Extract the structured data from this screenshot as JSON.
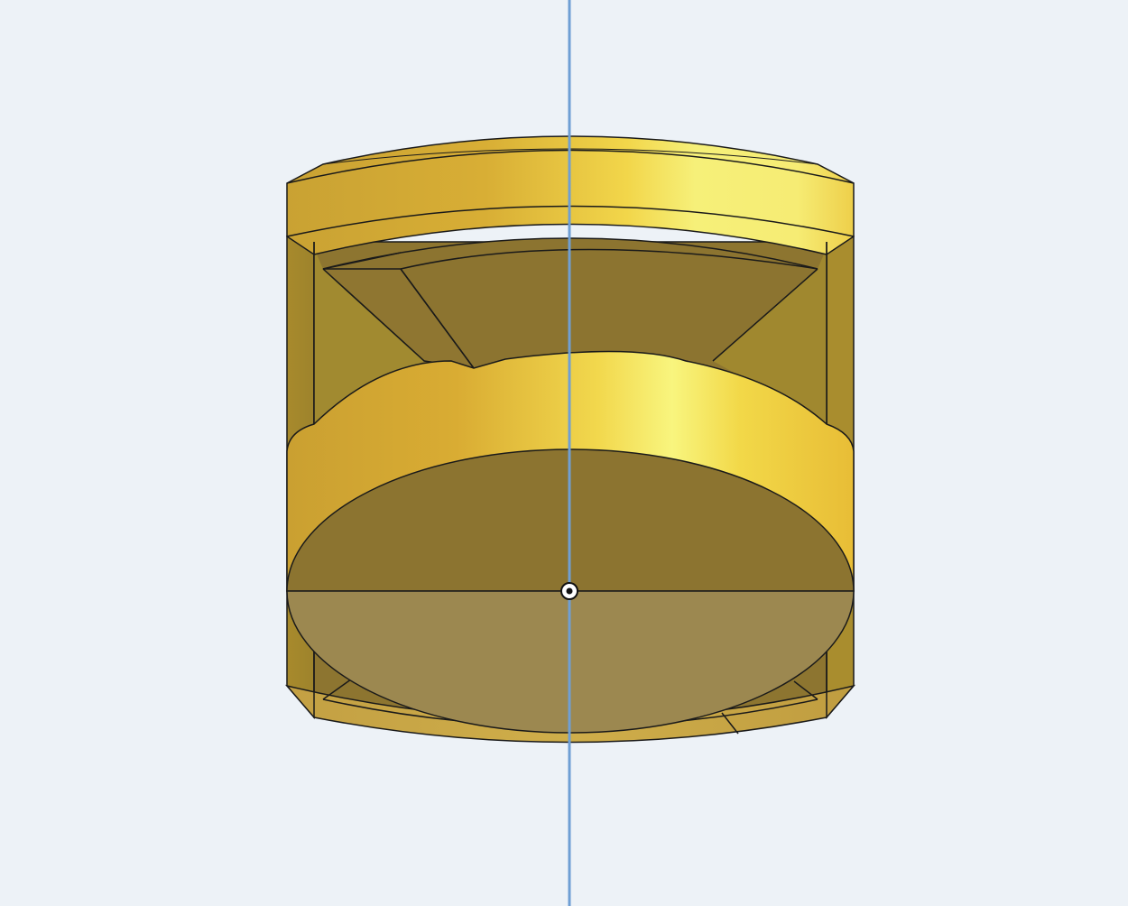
{
  "viewport": {
    "background_color": "#edf2f7",
    "model": {
      "name": "",
      "shape": "cylindrical part with recessed top cavity, cone-shaped inner walls and domed boss",
      "colors": {
        "body_gold": "#e8c23a",
        "highlight_yellow": "#f7f37a",
        "shadow_olive": "#8c7430",
        "inner_wall": "#a2882e",
        "edge_lines": "#1a1a1a"
      }
    },
    "axis": {
      "label": "",
      "color": "#6f9fd4",
      "orientation": "vertical"
    },
    "origin_marker": {
      "icon": "origin-point-icon"
    },
    "section_plane": {
      "color": "#a08a4e",
      "note": ""
    }
  }
}
